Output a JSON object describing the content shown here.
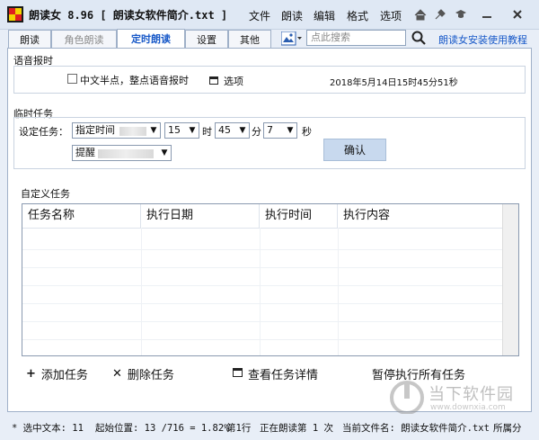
{
  "window": {
    "title": "朗读女 8.96 [ 朗读女软件简介.txt ]",
    "menu": [
      "文件",
      "朗读",
      "编辑",
      "格式",
      "选项"
    ],
    "toolbar_icons": [
      "home-icon",
      "pin-icon",
      "cap-icon",
      "minimize-icon",
      "close-icon"
    ]
  },
  "tabs": [
    {
      "label": "朗读",
      "state": "normal"
    },
    {
      "label": "角色朗读",
      "state": "disabled"
    },
    {
      "label": "定时朗读",
      "state": "active"
    },
    {
      "label": "设置",
      "state": "normal"
    },
    {
      "label": "其他",
      "state": "normal"
    }
  ],
  "search": {
    "placeholder": "点此搜索"
  },
  "help_link": "朗读女安装使用教程",
  "voice_time": {
    "title": "语音报时",
    "checkbox_label": "中文半点，整点语音报时",
    "checkbox_checked": false,
    "options_label": "选项",
    "datetime": "2018年5月14日15时45分51秒"
  },
  "temp_task": {
    "title": "临时任务",
    "set_label": "设定任务：",
    "mode_value": "指定时间",
    "hour_value": "15",
    "hour_unit": "时",
    "minute_value": "45",
    "minute_unit": "分",
    "second_value": "7",
    "second_unit": "秒",
    "action_value": "提醒",
    "confirm_label": "确认"
  },
  "custom_task": {
    "title": "自定义任务",
    "columns": [
      "任务名称",
      "执行日期",
      "执行时间",
      "执行内容"
    ],
    "rows": []
  },
  "actions": {
    "add": "添加任务",
    "delete": "删除任务",
    "details": "查看任务详情",
    "pause_all": "暂停执行所有任务"
  },
  "status": {
    "selected": "* 选中文本: 11",
    "start_pos": "起始位置: 13 /716 = 1.82%",
    "line": "第1行",
    "reading": "正在朗读第 1 次",
    "file": "当前文件名: 朗读女软件简介.txt",
    "tail": "所属分"
  },
  "watermark": {
    "brand": "当下软件园",
    "url": "www.downxia.com"
  },
  "colors": {
    "accent": "#1859c8",
    "confirm_bg": "#c8d9ee",
    "title_bg": "#dfe8f4"
  }
}
